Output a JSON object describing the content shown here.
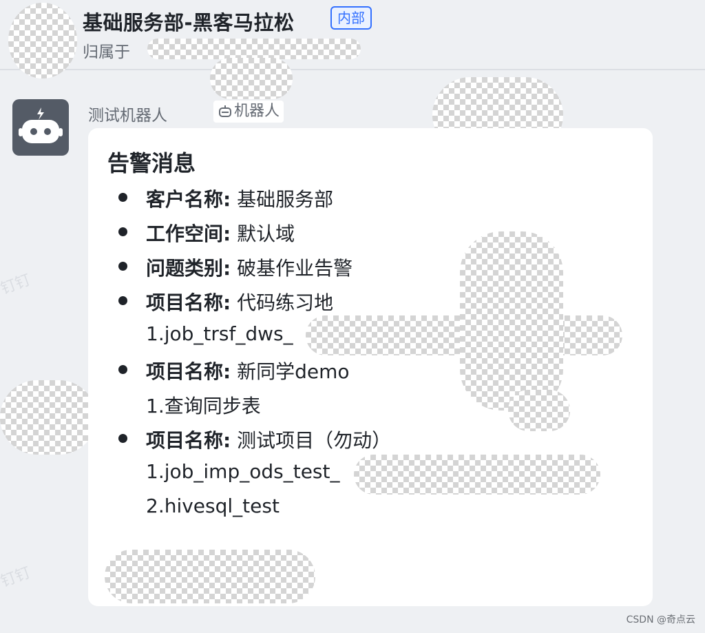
{
  "header": {
    "group_title": "基础服务部-黑客马拉松",
    "internal_tag": "内部",
    "belongs_prefix": "归属于"
  },
  "message": {
    "sender_name": "测试机器人",
    "sender_tag": "机器人",
    "card": {
      "title": "告警消息",
      "fields": [
        {
          "key": "客户名称:",
          "value": " 基础服务部"
        },
        {
          "key": "工作空间:",
          "value": " 默认域"
        },
        {
          "key": "问题类别:",
          "value": " 破基作业告警"
        }
      ],
      "projects": [
        {
          "key": "项目名称:",
          "value": " 代码练习地",
          "items": [
            "1.job_trsf_dws_"
          ]
        },
        {
          "key": "项目名称:",
          "value": " 新同学demo",
          "items": [
            "1.查询同步表"
          ]
        },
        {
          "key": "项目名称:",
          "value": " 测试项目（勿动）",
          "items": [
            "1.job_imp_ods_test_",
            "2.hivesql_test"
          ]
        }
      ]
    }
  },
  "watermark_text": "钉钉",
  "footer_credit": "CSDN @奇点云",
  "colors": {
    "accent": "#3370ff",
    "card_bg": "#ffffff",
    "page_bg": "#eef0f3",
    "avatar_bg": "#545b66"
  }
}
